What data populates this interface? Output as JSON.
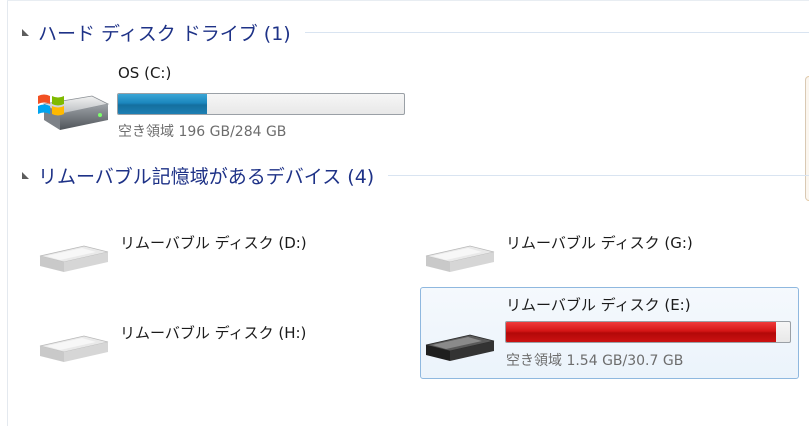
{
  "groups": {
    "hard_disk": {
      "title": "ハード ディスク ドライブ (1)"
    },
    "removable": {
      "title": "リムーバブル記憶域があるデバイス (4)"
    }
  },
  "drives": {
    "c": {
      "name": "OS (C:)",
      "free_label": "空き領域 196 GB/284 GB",
      "used_fraction": 0.31,
      "icon": "windows-hard-drive-icon",
      "bar_color": "#1b86bd"
    },
    "d": {
      "name": "リムーバブル ディスク (D:)",
      "icon": "removable-drive-icon"
    },
    "g": {
      "name": "リムーバブル ディスク (G:)",
      "icon": "removable-drive-icon"
    },
    "h": {
      "name": "リムーバブル ディスク (H:)",
      "icon": "removable-drive-icon"
    },
    "e": {
      "name": "リムーバブル ディスク (E:)",
      "free_label": "空き領域 1.54 GB/30.7 GB",
      "used_fraction": 0.95,
      "icon": "removable-drive-dark-icon",
      "bar_color": "#d41515",
      "selected": true
    }
  }
}
